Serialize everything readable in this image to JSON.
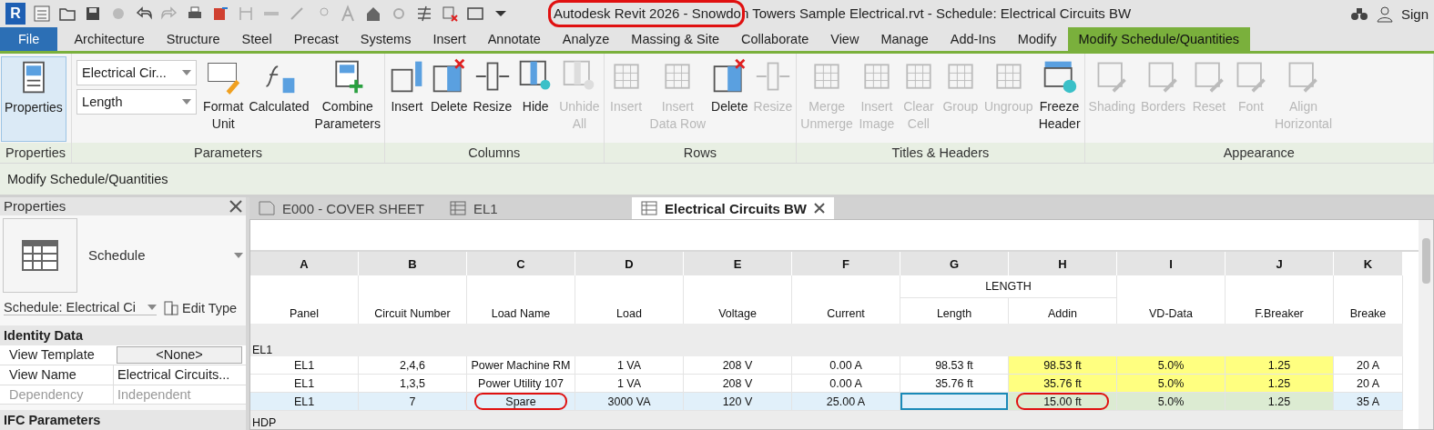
{
  "title_bar": {
    "logo": "R",
    "title": "Autodesk Revit 2026 - Snowdon Towers Sample Electrical.rvt - Schedule: Electrical Circuits BW",
    "title_circled": true,
    "sign_in": "Sign"
  },
  "ribbon_tabs": [
    {
      "label": "File",
      "kind": "file",
      "selected": false
    },
    {
      "label": "Architecture",
      "kind": "tab",
      "selected": false
    },
    {
      "label": "Structure",
      "kind": "tab",
      "selected": false
    },
    {
      "label": "Steel",
      "kind": "tab",
      "selected": false
    },
    {
      "label": "Precast",
      "kind": "tab",
      "selected": false
    },
    {
      "label": "Systems",
      "kind": "tab",
      "selected": false
    },
    {
      "label": "Insert",
      "kind": "tab",
      "selected": false
    },
    {
      "label": "Annotate",
      "kind": "tab",
      "selected": false
    },
    {
      "label": "Analyze",
      "kind": "tab",
      "selected": false
    },
    {
      "label": "Massing & Site",
      "kind": "tab",
      "selected": false
    },
    {
      "label": "Collaborate",
      "kind": "tab",
      "selected": false
    },
    {
      "label": "View",
      "kind": "tab",
      "selected": false
    },
    {
      "label": "Manage",
      "kind": "tab",
      "selected": false
    },
    {
      "label": "Add-Ins",
      "kind": "tab",
      "selected": false
    },
    {
      "label": "Modify",
      "kind": "tab",
      "selected": false
    },
    {
      "label": "Modify Schedule/Quantities",
      "kind": "context",
      "selected": true
    }
  ],
  "ribbon_panels": [
    {
      "title": "Properties",
      "controls": [
        {
          "kind": "big",
          "label": "Properties",
          "disabled": false,
          "selected": true
        }
      ]
    },
    {
      "title": "Parameters",
      "controls": [
        {
          "kind": "dropdowns",
          "values": [
            "Electrical Cir...",
            "Length"
          ]
        },
        {
          "kind": "button",
          "label": "Format\nUnit",
          "disabled": false,
          "selected": false
        },
        {
          "kind": "button",
          "label": "Calculated",
          "disabled": false,
          "selected": false
        },
        {
          "kind": "button",
          "label": "Combine\nParameters",
          "disabled": false,
          "selected": false
        }
      ]
    },
    {
      "title": "Columns",
      "controls": [
        {
          "kind": "button",
          "label": "Insert",
          "disabled": false,
          "selected": false
        },
        {
          "kind": "button",
          "label": "Delete",
          "disabled": false,
          "selected": false
        },
        {
          "kind": "button",
          "label": "Resize",
          "disabled": false,
          "selected": false
        },
        {
          "kind": "button",
          "label": "Hide",
          "disabled": false,
          "selected": false
        },
        {
          "kind": "button",
          "label": "Unhide\nAll",
          "disabled": true,
          "selected": false
        }
      ]
    },
    {
      "title": "Rows",
      "controls": [
        {
          "kind": "button",
          "label": "Insert",
          "disabled": true,
          "selected": false
        },
        {
          "kind": "button",
          "label": "Insert\nData Row",
          "disabled": true,
          "selected": false
        },
        {
          "kind": "button",
          "label": "Delete",
          "disabled": false,
          "selected": false
        },
        {
          "kind": "button",
          "label": "Resize",
          "disabled": true,
          "selected": false
        }
      ]
    },
    {
      "title": "Titles & Headers",
      "controls": [
        {
          "kind": "button",
          "label": "Merge\nUnmerge",
          "disabled": true,
          "selected": false
        },
        {
          "kind": "button",
          "label": "Insert\nImage",
          "disabled": true,
          "selected": false
        },
        {
          "kind": "button",
          "label": "Clear\nCell",
          "disabled": true,
          "selected": false
        },
        {
          "kind": "button",
          "label": "Group",
          "disabled": true,
          "selected": false
        },
        {
          "kind": "button",
          "label": "Ungroup",
          "disabled": true,
          "selected": false
        },
        {
          "kind": "button",
          "label": "Freeze\nHeader",
          "disabled": false,
          "selected": false
        }
      ]
    },
    {
      "title": "Appearance",
      "controls": [
        {
          "kind": "button",
          "label": "Shading",
          "disabled": true,
          "selected": false
        },
        {
          "kind": "button",
          "label": "Borders",
          "disabled": true,
          "selected": false
        },
        {
          "kind": "button",
          "label": "Reset",
          "disabled": true,
          "selected": false
        },
        {
          "kind": "button",
          "label": "Font",
          "disabled": true,
          "selected": false
        },
        {
          "kind": "button",
          "label": "Align\nHorizontal",
          "disabled": true,
          "selected": false
        }
      ]
    }
  ],
  "context_bar": {
    "label": "Modify Schedule/Quantities"
  },
  "properties": {
    "title": "Properties",
    "type_name": "Schedule",
    "selector": "Schedule: Electrical Ci",
    "edit_type": "Edit Type",
    "groups": [
      {
        "title": "Identity Data",
        "rows": [
          {
            "label": "View Template",
            "value": "<None>",
            "kind": "button",
            "disabled": false
          },
          {
            "label": "View Name",
            "value": "Electrical Circuits...",
            "kind": "text",
            "disabled": false
          },
          {
            "label": "Dependency",
            "value": "Independent",
            "kind": "text",
            "disabled": true
          }
        ]
      },
      {
        "title": "IFC Parameters"
      }
    ]
  },
  "view_tabs": [
    {
      "label": "E000 - COVER SHEET",
      "kind": "sheet",
      "selected": false,
      "closable": false
    },
    {
      "label": "EL1",
      "kind": "panel",
      "selected": false,
      "closable": false
    },
    {
      "label": "Electrical Circuits BW",
      "kind": "schedule",
      "selected": true,
      "closable": true
    }
  ],
  "schedule": {
    "letters": [
      "A",
      "B",
      "C",
      "D",
      "E",
      "F",
      "G",
      "H",
      "I",
      "J",
      "K"
    ],
    "group_header": {
      "label": "LENGTH"
    },
    "columns": [
      "Panel",
      "Circuit Number",
      "Load Name",
      "Load",
      "Voltage",
      "Current",
      "Length",
      "Addin",
      "VD-Data",
      "F.Breaker",
      "Breake"
    ],
    "groups": [
      {
        "label": "EL1",
        "rows": [
          {
            "selected": false,
            "cells": [
              {
                "text": "EL1"
              },
              {
                "text": "2,4,6"
              },
              {
                "text": "Power Machine RM"
              },
              {
                "text": "1 VA"
              },
              {
                "text": "208 V"
              },
              {
                "text": "0.00 A"
              },
              {
                "text": "98.53 ft"
              },
              {
                "text": "98.53 ft",
                "color": "#ffff80"
              },
              {
                "text": "5.0%",
                "color": "#ffff80"
              },
              {
                "text": "1.25",
                "color": "#ffff80"
              },
              {
                "text": "20 A"
              }
            ]
          },
          {
            "selected": false,
            "cells": [
              {
                "text": "EL1"
              },
              {
                "text": "1,3,5"
              },
              {
                "text": "Power Utility 107"
              },
              {
                "text": "1 VA"
              },
              {
                "text": "208 V"
              },
              {
                "text": "0.00 A"
              },
              {
                "text": "35.76 ft"
              },
              {
                "text": "35.76 ft",
                "color": "#ffff80"
              },
              {
                "text": "5.0%",
                "color": "#ffff80"
              },
              {
                "text": "1.25",
                "color": "#ffff80"
              },
              {
                "text": "20 A"
              }
            ]
          },
          {
            "selected": true,
            "cells": [
              {
                "text": "EL1"
              },
              {
                "text": "7"
              },
              {
                "text": "Spare",
                "circled": true
              },
              {
                "text": "3000 VA"
              },
              {
                "text": "120 V"
              },
              {
                "text": "25.00 A"
              },
              {
                "text": "",
                "active": true
              },
              {
                "text": "15.00 ft",
                "color": "#dcebd2",
                "circled": true
              },
              {
                "text": "5.0%",
                "color": "#dcebd2"
              },
              {
                "text": "1.25",
                "color": "#dcebd2"
              },
              {
                "text": "35 A"
              }
            ]
          }
        ]
      },
      {
        "label": "HDP"
      }
    ]
  }
}
